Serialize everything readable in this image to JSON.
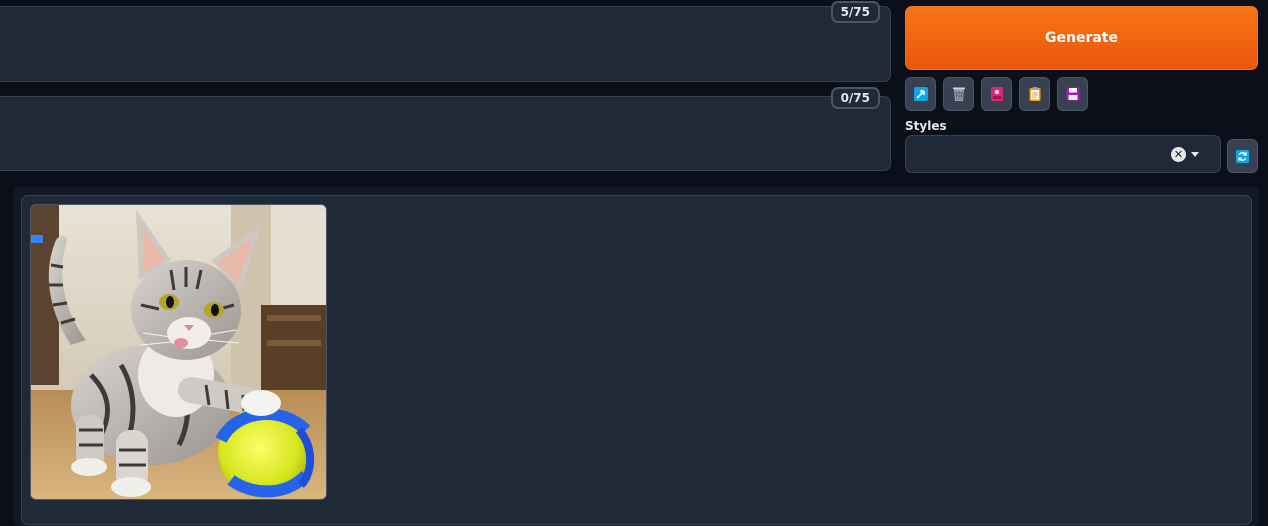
{
  "prompt": {
    "counter": "5/75",
    "value": ""
  },
  "negative_prompt": {
    "counter": "0/75",
    "value": ""
  },
  "generate": {
    "label": "Generate"
  },
  "toolbar": {
    "buttons": [
      {
        "icon": "arrow-check-icon"
      },
      {
        "icon": "trash-icon"
      },
      {
        "icon": "style-card-icon"
      },
      {
        "icon": "clipboard-icon"
      },
      {
        "icon": "save-icon"
      }
    ]
  },
  "styles": {
    "label": "Styles",
    "selected": "",
    "clear_symbol": "✕"
  },
  "gallery": {
    "images": [
      {
        "subject": "kitten-playing-with-ball"
      }
    ]
  },
  "colors": {
    "accent": "#f97316",
    "background": "#0b0f19",
    "panel": "#1f2937",
    "border": "#374151"
  }
}
